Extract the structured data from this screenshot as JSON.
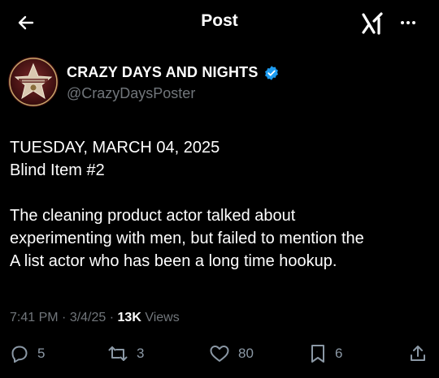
{
  "header": {
    "title": "Post",
    "back_icon": "arrow-left-icon",
    "grok_icon": "grok-icon",
    "more_icon": "more-horizontal-icon"
  },
  "author": {
    "name": "CRAZY DAYS AND NIGHTS",
    "handle": "@CrazyDaysPoster",
    "verified": true,
    "verified_color": "#1d9bf0"
  },
  "post": {
    "line1": "TUESDAY, MARCH 04, 2025",
    "line2": "Blind Item #2",
    "line3": "The cleaning product actor talked about",
    "line4": "experimenting with men, but failed to mention the",
    "line5": "A list actor who has been a long time hookup."
  },
  "meta": {
    "time": "7:41 PM",
    "separator": " · ",
    "date": "3/4/25",
    "views_count": "13K",
    "views_label": " Views"
  },
  "actions": {
    "replies": "5",
    "reposts": "3",
    "likes": "80",
    "bookmarks": "6"
  },
  "colors": {
    "background": "#000000",
    "text": "#ffffff",
    "secondary": "#71767b",
    "icon": "#8b98a5"
  }
}
